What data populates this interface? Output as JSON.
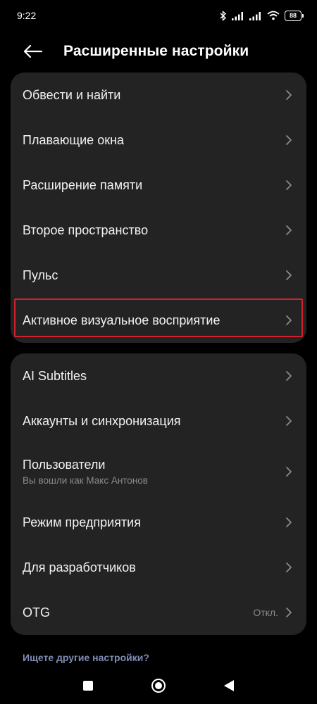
{
  "status_bar": {
    "time": "9:22",
    "battery": "88",
    "icons": [
      "bluetooth-icon",
      "signal-icon",
      "signal-icon",
      "wifi-icon",
      "battery-icon"
    ]
  },
  "header": {
    "title": "Расширенные настройки",
    "back_icon": "back-arrow-icon"
  },
  "card1": {
    "items": [
      {
        "label": "Обвести и найти"
      },
      {
        "label": "Плавающие окна"
      },
      {
        "label": "Расширение памяти"
      },
      {
        "label": "Второе пространство"
      },
      {
        "label": "Пульс"
      },
      {
        "label": "Активное визуальное восприятие",
        "highlighted": true
      }
    ]
  },
  "card2": {
    "items": [
      {
        "label": "AI Subtitles"
      },
      {
        "label": "Аккаунты и синхронизация"
      },
      {
        "label": "Пользователи",
        "subtitle": "Вы вошли как Макс Антонов"
      },
      {
        "label": "Режим предприятия"
      },
      {
        "label": "Для разработчиков"
      },
      {
        "label": "OTG",
        "value": "Откл."
      }
    ]
  },
  "footer": {
    "more_link": "Ищете другие настройки?"
  },
  "nav": {
    "icons": [
      "recents-square-icon",
      "home-circle-icon",
      "back-triangle-icon"
    ]
  },
  "colors": {
    "background": "#000000",
    "card": "#232323",
    "highlight": "#d2202f",
    "link": "#7f8bb4",
    "secondary_text": "#8b8b8b"
  }
}
